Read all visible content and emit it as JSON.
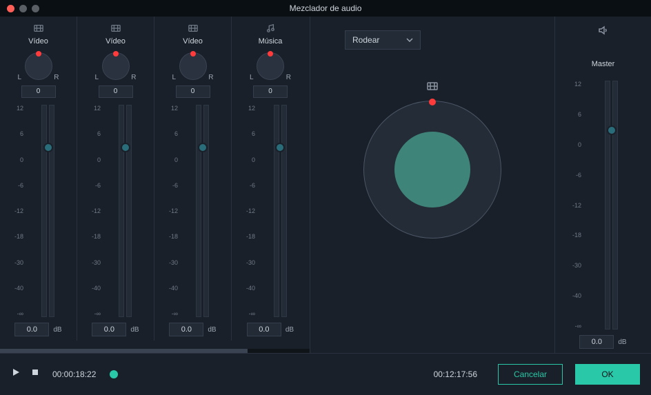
{
  "window": {
    "title": "Mezclador de audio"
  },
  "channels": [
    {
      "icon": "video",
      "label": "Vídeo",
      "pan_left": "L",
      "pan_right": "R",
      "pan_value": "0",
      "db_value": "0.0",
      "db_unit": "dB"
    },
    {
      "icon": "video",
      "label": "Vídeo",
      "pan_left": "L",
      "pan_right": "R",
      "pan_value": "0",
      "db_value": "0.0",
      "db_unit": "dB"
    },
    {
      "icon": "video",
      "label": "Vídeo",
      "pan_left": "L",
      "pan_right": "R",
      "pan_value": "0",
      "db_value": "0.0",
      "db_unit": "dB"
    },
    {
      "icon": "music",
      "label": "Música",
      "pan_left": "L",
      "pan_right": "R",
      "pan_value": "0",
      "db_value": "0.0",
      "db_unit": "dB"
    }
  ],
  "scale": [
    "12",
    "6",
    "0",
    "-6",
    "-12",
    "-18",
    "-30",
    "-40",
    "-∞"
  ],
  "center": {
    "dropdown_label": "Rodear"
  },
  "master": {
    "label": "Master",
    "db_value": "0.0",
    "db_unit": "dB",
    "scale": [
      "12",
      "6",
      "0",
      "-6",
      "-12",
      "-18",
      "-30",
      "-40",
      "-∞"
    ]
  },
  "transport": {
    "current_time": "00:00:18:22",
    "total_time": "00:12:17:56",
    "cancel_label": "Cancelar",
    "ok_label": "OK"
  }
}
